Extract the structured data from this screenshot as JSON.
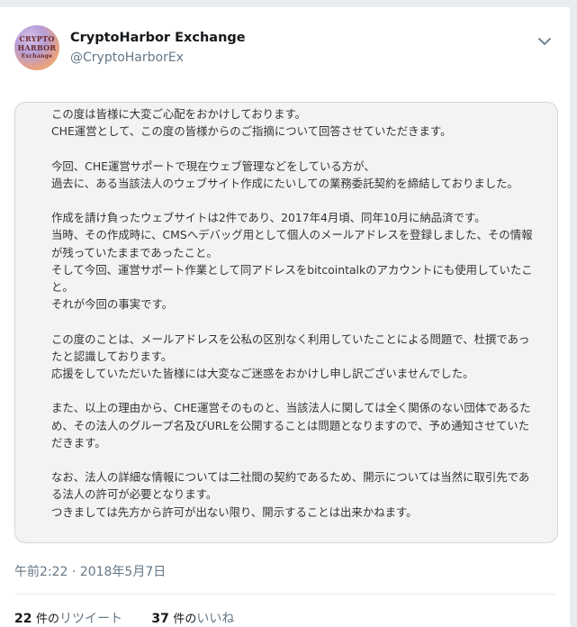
{
  "tweet": {
    "author": {
      "display_name": "CryptoHarbor Exchange",
      "handle": "@CryptoHarborEx",
      "avatar_text": [
        "CRYPTO",
        "HARBOR",
        "Exchange"
      ]
    },
    "menu_icon": "chevron-down-icon",
    "image_text": [
      "この度は皆様に大変ご心配をおかけしております。\nCHE運営として、この度の皆様からのご指摘について回答させていただきます。",
      "今回、CHE運営サポートで現在ウェブ管理などをしている方が、\n過去に、ある当該法人のウェブサイト作成にたいしての業務委託契約を締結しておりました。",
      "作成を請け負ったウェブサイトは2件であり、2017年4月頃、同年10月に納品済です。\n当時、その作成時に、CMSへデバッグ用として個人のメールアドレスを登録しました、その情報が残っていたままであったこと。\nそして今回、運営サポート作業として同アドレスをbitcointalkのアカウントにも使用していたこと。\nそれが今回の事実です。",
      "この度のことは、メールアドレスを公私の区別なく利用していたことによる問題で、杜撰であったと認識しております。\n応援をしていただいた皆様には大変なご迷惑をおかけし申し訳ございませんでした。",
      "また、以上の理由から、CHE運営そのものと、当該法人に関しては全く関係のない団体であるため、その法人のグループ名及びURLを公開することは問題となりますので、予め通知させていただきます。",
      "なお、法人の詳細な情報については二社間の契約であるため、開示については当然に取引先である法人の許可が必要となります。\nつきましては先方から許可が出ない限り、開示することは出来かねます。"
    ],
    "timestamp": "午前2:22 · 2018年5月7日",
    "retweets": {
      "count": "22",
      "unit": "件の",
      "label": "リツイート"
    },
    "likes": {
      "count": "37",
      "unit": "件の",
      "label": "いいね"
    }
  }
}
